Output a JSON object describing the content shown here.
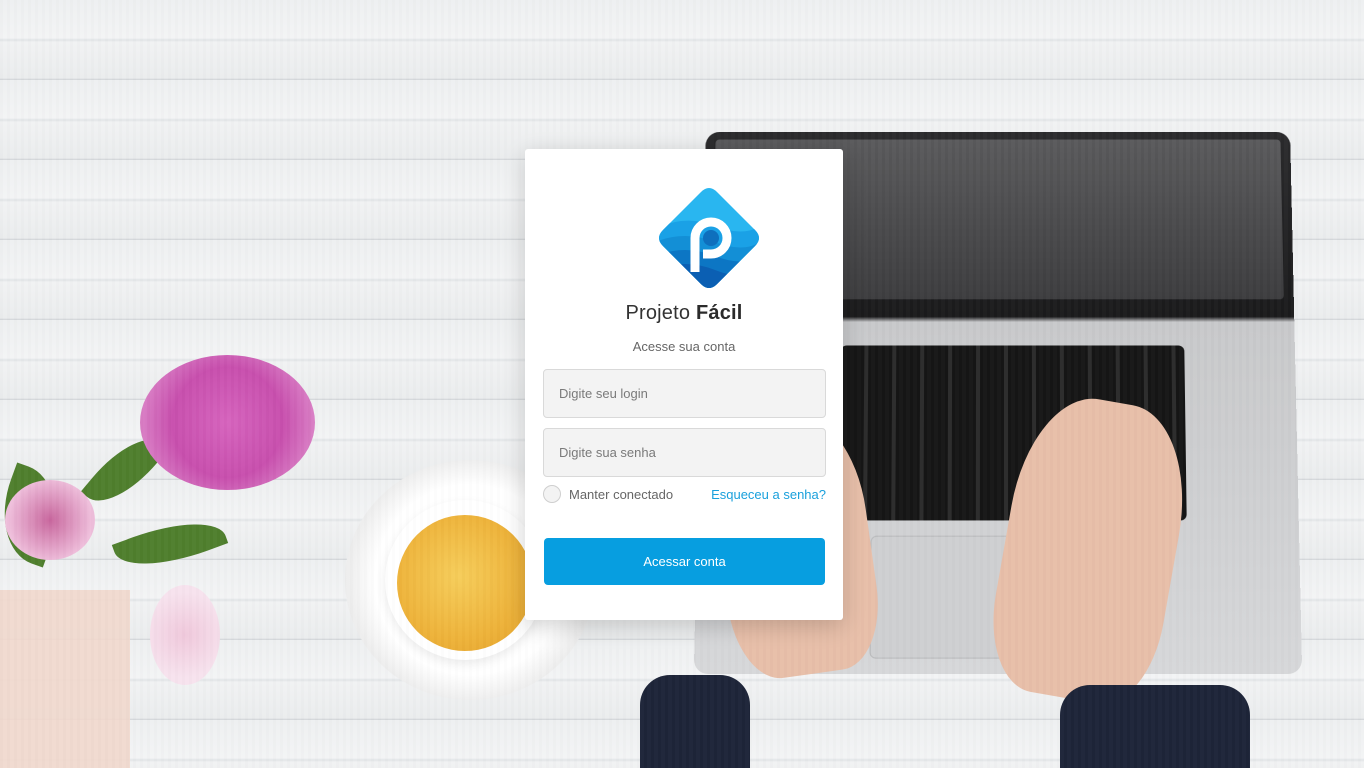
{
  "brand": {
    "name_regular": "Projeto",
    "name_bold": "Fácil",
    "logo_letter": "p",
    "colors": {
      "logo_light": "#29b6f0",
      "logo_mid": "#138fd6",
      "logo_dark": "#0b5fb3"
    }
  },
  "login": {
    "subtitle": "Acesse sua conta",
    "login_placeholder": "Digite seu login",
    "password_placeholder": "Digite sua senha",
    "remember_label": "Manter conectado",
    "forgot_label": "Esqueceu a senha?",
    "submit_label": "Acessar conta",
    "remember_checked": false
  },
  "colors": {
    "accent": "#079ee0",
    "link": "#1aa0dc",
    "card_bg": "#ffffff"
  }
}
